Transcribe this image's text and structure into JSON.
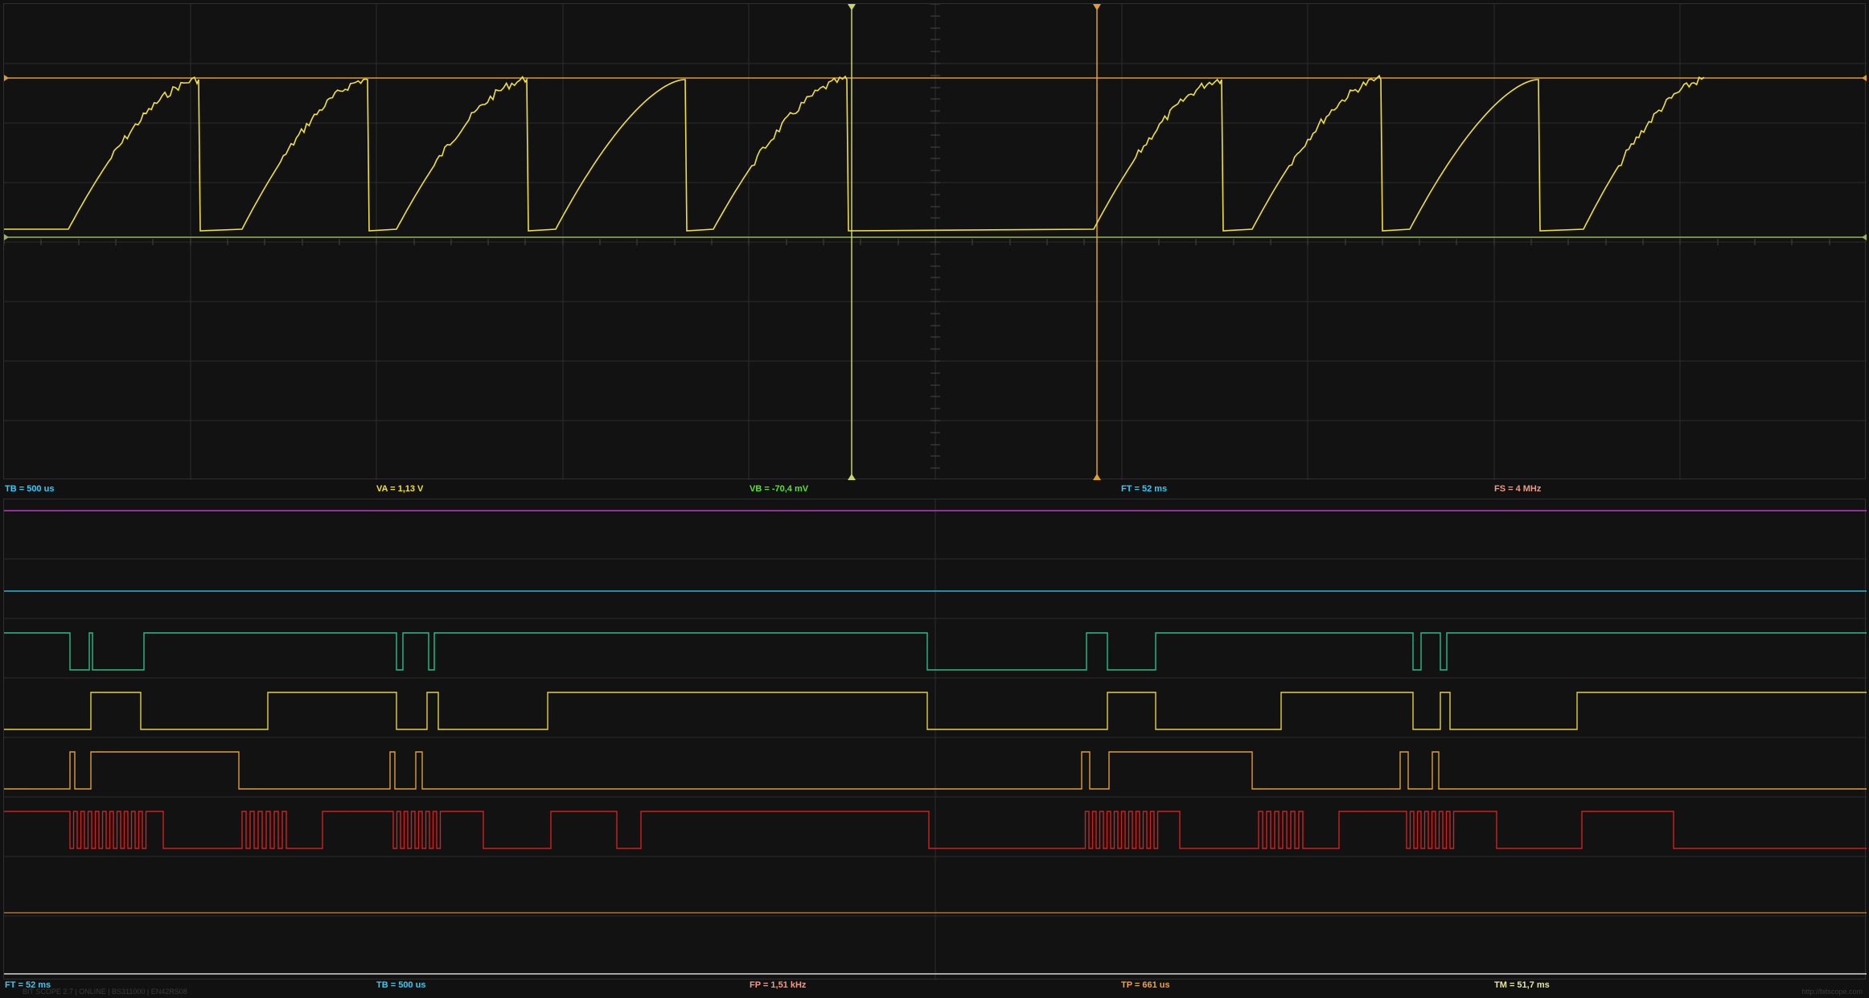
{
  "scope": {
    "trigger_level_fraction": 0.16,
    "cursors": [
      {
        "name": "cursor-a",
        "color": "#c9d46a",
        "position_fraction": 0.455
      },
      {
        "name": "cursor-b",
        "color": "#e0a030",
        "position_fraction": 0.587
      }
    ],
    "trace_color": "#f1e03a",
    "level_colors": {
      "high": "#e09a2a",
      "low": "#9ab35c"
    }
  },
  "status_top": {
    "tb": {
      "text": "TB = 500 us",
      "color": "#3fc6f0"
    },
    "va": {
      "text": "VA = 1,13 V",
      "color": "#f1e03a"
    },
    "vb": {
      "text": "VB = -70,4 mV",
      "color": "#5fdc3a"
    },
    "ft": {
      "text": "FT = 52 ms",
      "color": "#3fc6f0"
    },
    "fs": {
      "text": "FS = 4 MHz",
      "color": "#f09a86"
    }
  },
  "status_bottom": {
    "ft": {
      "text": "FT = 52 ms",
      "color": "#3fc6f0"
    },
    "tb": {
      "text": "TB = 500 us",
      "color": "#3fc6f0"
    },
    "fp": {
      "text": "FP = 1,51 kHz",
      "color": "#f09a86"
    },
    "tp": {
      "text": "TP = 661 us",
      "color": "#f0a040"
    },
    "tm": {
      "text": "TM = 51,7 ms",
      "color": "#e6e6a0"
    }
  },
  "footer": {
    "left": "BIT SCOPE 2.7 | ONLINE | BS311000 | EN42RS08",
    "right": "http://bitscope.com"
  },
  "logic_channels": [
    {
      "name": "channel-0",
      "color": "#c238c2"
    },
    {
      "name": "channel-1",
      "color": "#2ab4d8"
    },
    {
      "name": "channel-2",
      "color": "#26c08a"
    },
    {
      "name": "channel-3",
      "color": "#e6d23a"
    },
    {
      "name": "channel-4",
      "color": "#e0a030"
    },
    {
      "name": "channel-5",
      "color": "#d02020"
    },
    {
      "name": "channel-6",
      "color": "#b07030"
    },
    {
      "name": "channel-7",
      "color": "#d8d8d8"
    }
  ]
}
